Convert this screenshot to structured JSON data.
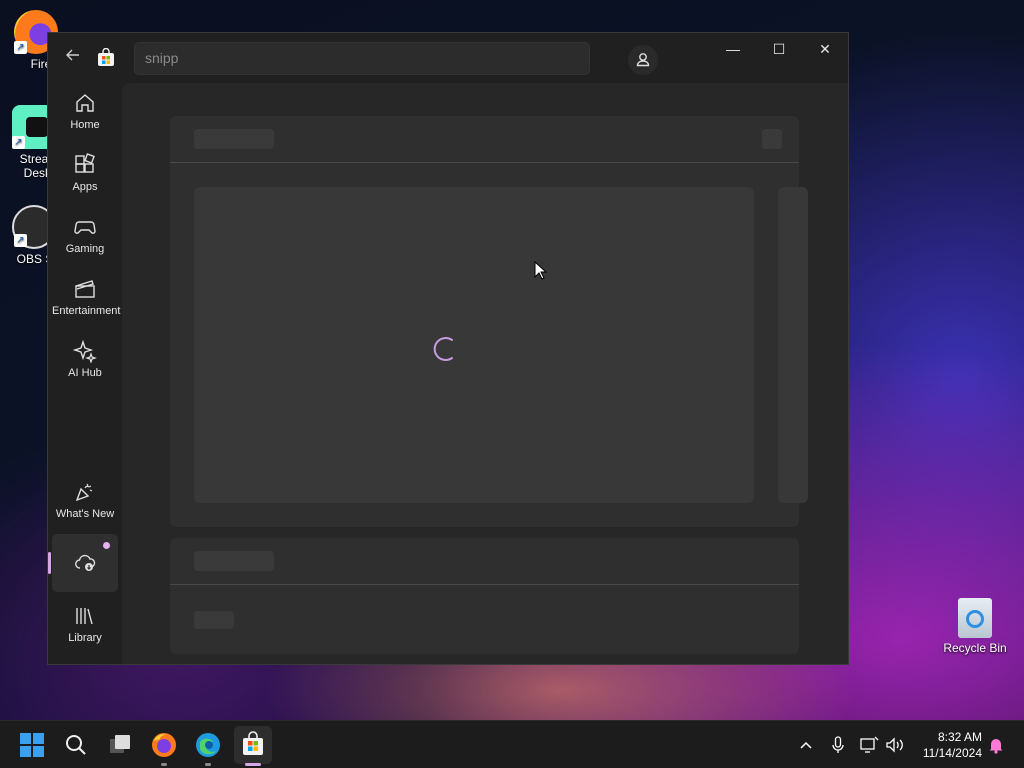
{
  "desktop": {
    "icons": [
      {
        "label": "Firefo"
      },
      {
        "label": "Stream\nDeskt"
      },
      {
        "label": "OBS Stu"
      },
      {
        "label": "Recycle Bin"
      }
    ]
  },
  "window": {
    "search_value": "snipp",
    "buttons": {
      "minimize": "—",
      "maximize": "☐",
      "close": "✕"
    }
  },
  "sidebar": {
    "items": [
      {
        "label": "Home"
      },
      {
        "label": "Apps"
      },
      {
        "label": "Gaming"
      },
      {
        "label": "Entertainment"
      },
      {
        "label": "AI Hub"
      },
      {
        "label": "What's New"
      },
      {
        "label": ""
      },
      {
        "label": "Library"
      }
    ]
  },
  "taskbar": {
    "time": "8:32 AM",
    "date": "11/14/2024"
  },
  "colors": {
    "accent": "#d7a6e8",
    "spinner": "#c79be0"
  }
}
